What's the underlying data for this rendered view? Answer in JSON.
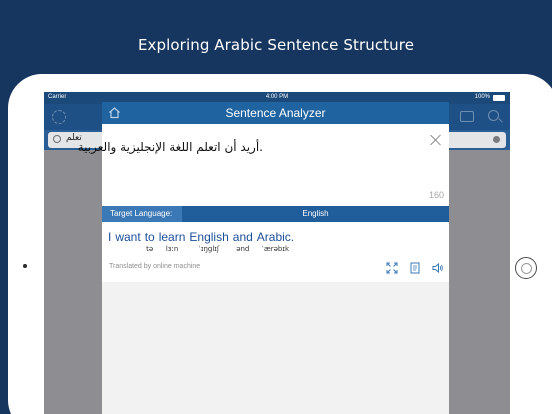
{
  "promo": {
    "title": "Exploring Arabic Sentence Structure"
  },
  "status_bar": {
    "carrier": "Carrier",
    "time": "4:00 PM",
    "battery": "100%"
  },
  "search": {
    "value": "تعلم"
  },
  "modal": {
    "title": "Sentence Analyzer",
    "input_text": ".أريد أن اتعلم اللغة الإنجليزية والعربية",
    "char_count": "160",
    "target_label": "Target Language:",
    "target_language": "English",
    "translation_words": [
      {
        "text": "I",
        "ipa": ""
      },
      {
        "text": "want",
        "ipa": ""
      },
      {
        "text": "to",
        "ipa": "tə"
      },
      {
        "text": "learn",
        "ipa": "lɜːn"
      },
      {
        "text": "English",
        "ipa": "ˈɪŋglɪʃ"
      },
      {
        "text": "and",
        "ipa": "ənd"
      },
      {
        "text": "Arabic.",
        "ipa": "ˈærəbɪk"
      }
    ],
    "translated_by": "Translated by online machine"
  },
  "icons": [
    "home-icon",
    "close-icon",
    "expand-icon",
    "book-icon",
    "speaker-icon",
    "gear-icon",
    "keyboard-icon",
    "search-icon"
  ],
  "colors": {
    "background": "#16365f",
    "header": "#2063a1",
    "link_text": "#1a4f9a"
  }
}
